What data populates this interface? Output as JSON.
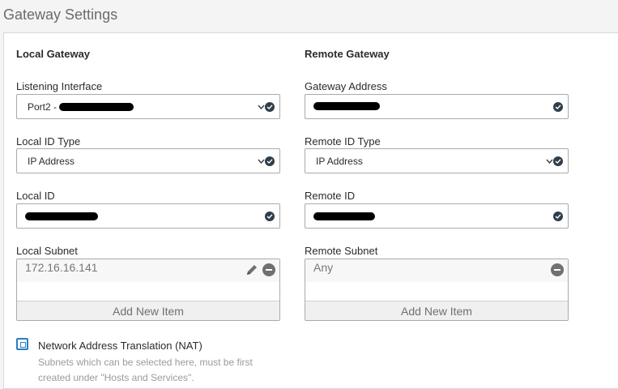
{
  "page": {
    "title": "Gateway Settings"
  },
  "local": {
    "section_title": "Local Gateway",
    "listening_interface": {
      "label": "Listening Interface",
      "value": "Port2 -"
    },
    "id_type": {
      "label": "Local ID Type",
      "value": "IP Address"
    },
    "local_id": {
      "label": "Local ID",
      "value": ""
    },
    "subnet": {
      "label": "Local Subnet",
      "items": [
        "172.16.16.141"
      ],
      "add_label": "Add New Item"
    }
  },
  "remote": {
    "section_title": "Remote Gateway",
    "gateway_address": {
      "label": "Gateway Address",
      "value": ""
    },
    "id_type": {
      "label": "Remote ID Type",
      "value": "IP Address"
    },
    "remote_id": {
      "label": "Remote ID",
      "value": ""
    },
    "subnet": {
      "label": "Remote Subnet",
      "items": [
        "Any"
      ],
      "add_label": "Add New Item"
    }
  },
  "nat": {
    "label": "Network Address Translation (NAT)",
    "help": "Subnets which can be selected here, must be first created under \"Hosts and Services\".",
    "checked": false
  },
  "icons": {
    "check": "check-circle-icon",
    "caret": "chevron-down-icon",
    "remove": "minus-circle-icon",
    "edit": "pencil-icon",
    "checkbox": "checkbox-icon"
  },
  "colors": {
    "accent": "#2a7fbf",
    "icon_dark": "#2f3e4a",
    "muted": "#9a9a9a"
  }
}
